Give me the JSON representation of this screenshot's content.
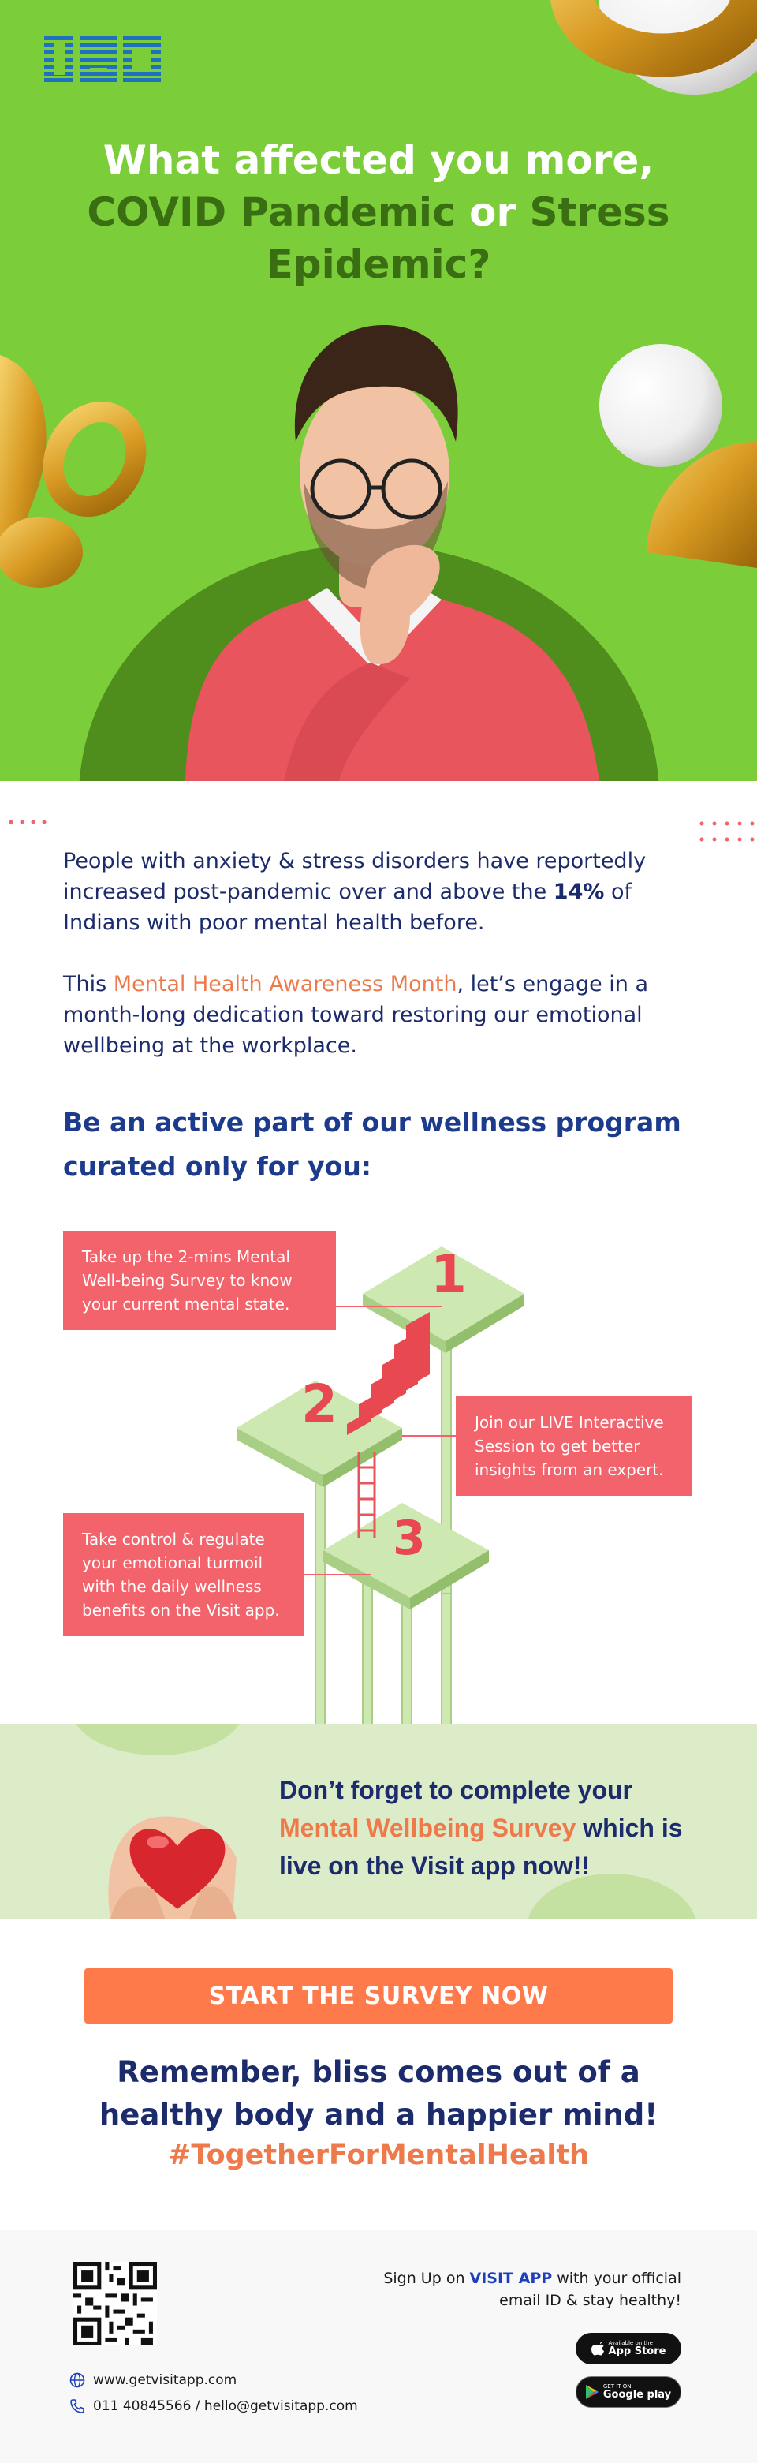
{
  "hero": {
    "logo_text": "IBM",
    "title_line1": "What affected you more,",
    "title_part_a": "COVID Pandemic ",
    "title_or": "or",
    "title_part_b": " Stress Epidemic?"
  },
  "intro": {
    "p1_a": "People with anxiety & stress disorders have reportedly increased post-pandemic over and above the ",
    "p1_bold": "14%",
    "p1_b": " of Indians with poor mental health before.",
    "p2_a": "This ",
    "p2_highlight": "Mental Health Awareness Month",
    "p2_b": ", let’s engage in a month-long dedication toward restoring our emotional wellbeing at the workplace."
  },
  "program_heading": "Be an active part of our wellness program curated only for you:",
  "steps": [
    {
      "number": "1",
      "text": "Take up the 2-mins Mental Well-being Survey to know your current mental state."
    },
    {
      "number": "2",
      "text": "Join our LIVE Interactive Session to get better insights from an expert."
    },
    {
      "number": "3",
      "text": "Take control & regulate your emotional turmoil with the daily wellness benefits on the Visit  app."
    }
  ],
  "reminder": {
    "a": "Don’t forget to complete your ",
    "highlight": "Mental Wellbeing Survey",
    "b": " which is live on the Visit app now!!"
  },
  "cta_label": "START THE SURVEY NOW",
  "closing": "Remember, bliss comes out of a healthy body and a happier mind!",
  "hashtag": "#TogetherForMentalHealth",
  "footer": {
    "signup_a": "Sign Up on ",
    "signup_brand": "VISIT APP",
    "signup_b": " with your official",
    "signup_c": "email ID & stay healthy!",
    "app_store_small": "Available on the",
    "app_store": "App Store",
    "play_small": "GET IT ON",
    "play": "Google play",
    "website": "www.getvisitapp.com",
    "contact": "011 40845566 / hello@getvisitapp.com"
  },
  "colors": {
    "hero_green": "#7ccd3a",
    "dark_green": "#4f8e1d",
    "navy": "#1c2b6b",
    "orange": "#ee7a4b",
    "step_red": "#f2636b",
    "band_green": "#dcecc9"
  }
}
